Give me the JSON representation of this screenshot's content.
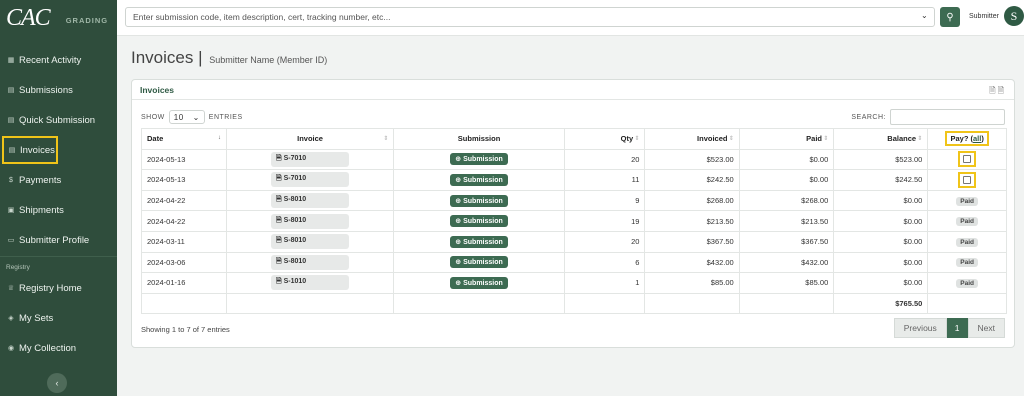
{
  "brand": {
    "logo": "CAC",
    "tag": "GRADING"
  },
  "sidebar": {
    "items": [
      {
        "label": "Recent Activity",
        "icon": "grid-icon"
      },
      {
        "label": "Submissions",
        "icon": "document-icon"
      },
      {
        "label": "Quick Submission",
        "icon": "document-icon"
      },
      {
        "label": "Invoices",
        "icon": "invoice-icon"
      },
      {
        "label": "Payments",
        "icon": "dollar-icon"
      },
      {
        "label": "Shipments",
        "icon": "box-icon"
      },
      {
        "label": "Submitter Profile",
        "icon": "id-card-icon"
      }
    ],
    "section_label": "Registry",
    "registry_items": [
      {
        "label": "Registry Home",
        "icon": "trophy-icon"
      },
      {
        "label": "My Sets",
        "icon": "layers-icon"
      },
      {
        "label": "My Collection",
        "icon": "collection-icon"
      }
    ],
    "collapse": "‹"
  },
  "topbar": {
    "search_placeholder": "Enter submission code, item description, cert, tracking number, etc...",
    "user_label": "Submitter",
    "avatar_letter": "S"
  },
  "page": {
    "title": "Invoices",
    "separator": "|",
    "subtitle": "Submitter Name (Member ID)"
  },
  "card": {
    "title": "Invoices",
    "show_label": "SHOW",
    "entries_label": "ENTRIES",
    "page_size": "10",
    "search_label": "SEARCH:",
    "columns": [
      "Date",
      "Invoice",
      "Submission",
      "Qty",
      "Invoiced",
      "Paid",
      "Balance"
    ],
    "pay_label": "Pay? (",
    "pay_all": "all",
    "pay_close": ")",
    "rows": [
      {
        "date": "2024-05-13",
        "invoice": "S-7010",
        "submission": "Submission",
        "qty": "20",
        "invoiced": "$523.00",
        "paid": "$0.00",
        "balance": "$523.00",
        "pay": "checkbox"
      },
      {
        "date": "2024-05-13",
        "invoice": "S-7010",
        "submission": "Submission",
        "qty": "11",
        "invoiced": "$242.50",
        "paid": "$0.00",
        "balance": "$242.50",
        "pay": "checkbox"
      },
      {
        "date": "2024-04-22",
        "invoice": "S-8010",
        "submission": "Submission",
        "qty": "9",
        "invoiced": "$268.00",
        "paid": "$268.00",
        "balance": "$0.00",
        "pay": "Paid"
      },
      {
        "date": "2024-04-22",
        "invoice": "S-8010",
        "submission": "Submission",
        "qty": "19",
        "invoiced": "$213.50",
        "paid": "$213.50",
        "balance": "$0.00",
        "pay": "Paid"
      },
      {
        "date": "2024-03-11",
        "invoice": "S-8010",
        "submission": "Submission",
        "qty": "20",
        "invoiced": "$367.50",
        "paid": "$367.50",
        "balance": "$0.00",
        "pay": "Paid"
      },
      {
        "date": "2024-03-06",
        "invoice": "S-8010",
        "submission": "Submission",
        "qty": "6",
        "invoiced": "$432.00",
        "paid": "$432.00",
        "balance": "$0.00",
        "pay": "Paid"
      },
      {
        "date": "2024-01-16",
        "invoice": "S-1010",
        "submission": "Submission",
        "qty": "1",
        "invoiced": "$85.00",
        "paid": "$85.00",
        "balance": "$0.00",
        "pay": "Paid"
      }
    ],
    "total_balance": "$765.50",
    "showing": "Showing 1 to 7 of 7 entries",
    "pager": {
      "prev": "Previous",
      "current": "1",
      "next": "Next"
    }
  },
  "colors": {
    "sidebar": "#2f4d3c",
    "accent": "#3d6b52",
    "highlight": "#f0c419"
  }
}
